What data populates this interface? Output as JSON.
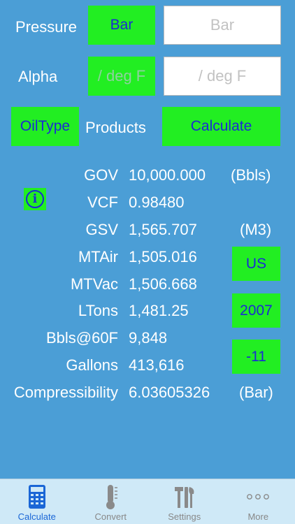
{
  "inputs": {
    "pressure": {
      "label": "Pressure",
      "unit_button": "Bar",
      "field_placeholder": "Bar"
    },
    "alpha": {
      "label": "Alpha",
      "unit_button": "/ deg F",
      "field_placeholder": "/ deg F"
    }
  },
  "actions": {
    "oiltype": "OilType",
    "products_label": "Products",
    "calculate": "Calculate"
  },
  "results": [
    {
      "label": "GOV",
      "value": "10,000.000"
    },
    {
      "label": "VCF",
      "value": "0.98480"
    },
    {
      "label": "GSV",
      "value": "1,565.707"
    },
    {
      "label": "MTAir",
      "value": "1,505.016"
    },
    {
      "label": "MTVac",
      "value": "1,506.668"
    },
    {
      "label": "LTons",
      "value": "1,481.25"
    },
    {
      "label": "Bbls@60F",
      "value": "9,848"
    },
    {
      "label": "Gallons",
      "value": "413,616"
    },
    {
      "label": "Compressibility",
      "value": "6.03605326"
    }
  ],
  "units": {
    "gov": "(Bbls)",
    "gsv": "(M3)",
    "compressibility": "(Bar)"
  },
  "side_buttons": {
    "region": "US",
    "year": "2007",
    "table": "-11"
  },
  "tabs": [
    {
      "label": "Calculate"
    },
    {
      "label": "Convert"
    },
    {
      "label": "Settings"
    },
    {
      "label": "More"
    }
  ],
  "colors": {
    "background": "#4b9ed6",
    "button_green": "#22ee22",
    "button_text": "#1a2bd4",
    "tabbar": "#cfe9f7",
    "active_tab": "#1a66d6"
  }
}
